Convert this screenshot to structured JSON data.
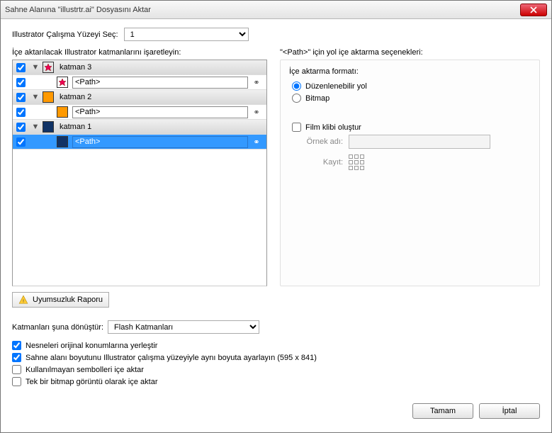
{
  "title": "Sahne Alanına \"illustrtr.ai\" Dosyasını Aktar",
  "artboard": {
    "label": "Illustrator Çalışma Yüzeyi Seç:",
    "value": "1"
  },
  "layers_label": "İçe aktarılacak Illustrator katmanlarını işaretleyin:",
  "layers": [
    {
      "name": "katman 3",
      "type": "group",
      "swatch": "star-pink"
    },
    {
      "name": "<Path>",
      "type": "item",
      "swatch": "star-pink"
    },
    {
      "name": "katman 2",
      "type": "group",
      "swatch": "sq-orange"
    },
    {
      "name": "<Path>",
      "type": "item",
      "swatch": "sq-orange"
    },
    {
      "name": "katman 1",
      "type": "group",
      "swatch": "sq-navy"
    },
    {
      "name": "<Path>",
      "type": "item",
      "swatch": "sq-navy",
      "selected": true
    }
  ],
  "report_btn": "Uyumsuzluk Raporu",
  "options": {
    "title": "\"<Path>\" için yol içe aktarma seçenekleri:",
    "format_label": "İçe aktarma formatı:",
    "radio_editable": "Düzenlenebilir yol",
    "radio_bitmap": "Bitmap",
    "chk_movie": "Film klibi oluştur",
    "instance_label": "Örnek adı:",
    "instance_value": "",
    "registration_label": "Kayıt:"
  },
  "convert": {
    "label": "Katmanları şuna dönüştür:",
    "value": "Flash Katmanları"
  },
  "checks": {
    "orig_pos": "Nesneleri orijinal konumlarına yerleştir",
    "stage_size": "Sahne alanı boyutunu Illustrator çalışma yüzeyiyle aynı boyuta ayarlayın (595 x 841)",
    "unused_sym": "Kullanılmayan sembolleri içe aktar",
    "single_bmp": "Tek bir bitmap görüntü olarak içe aktar"
  },
  "buttons": {
    "ok": "Tamam",
    "cancel": "İptal"
  }
}
